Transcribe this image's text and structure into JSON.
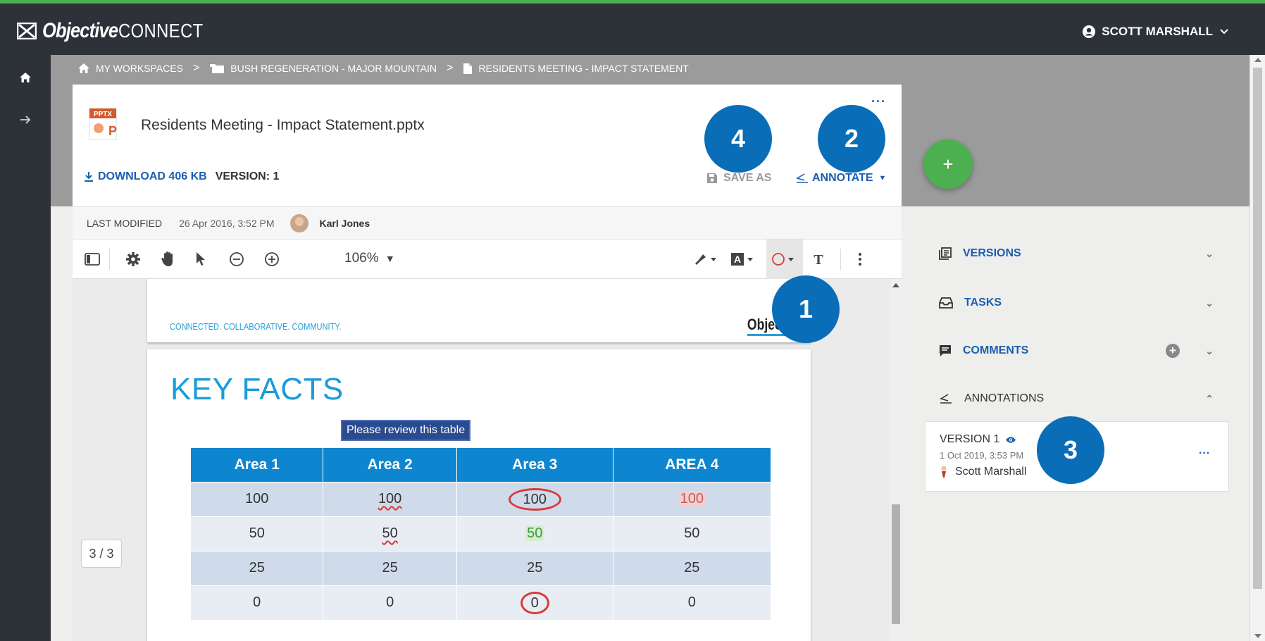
{
  "app": {
    "brand": "Objective",
    "product": "CONNECT",
    "accent_color": "#4caf50",
    "link_color": "#1a5fae",
    "callout_color": "#0a6db8"
  },
  "user": {
    "name": "SCOTT MARSHALL"
  },
  "breadcrumb": {
    "items": [
      {
        "label": "MY WORKSPACES",
        "icon": "home-icon"
      },
      {
        "label": "BUSH REGENERATION - MAJOR MOUNTAIN",
        "icon": "folder-icon"
      },
      {
        "label": "RESIDENTS MEETING - IMPACT STATEMENT",
        "icon": "document-icon"
      }
    ],
    "separator": ">"
  },
  "document": {
    "file_type": "PPTX",
    "title": "Residents Meeting - Impact Statement.pptx",
    "more": "···",
    "download_label": "DOWNLOAD 406 KB",
    "version_label": "VERSION: 1",
    "save_as_label": "SAVE AS",
    "annotate_label": "ANNOTATE"
  },
  "meta": {
    "last_modified_label": "LAST MODIFIED",
    "last_modified_date": "26 Apr 2016, 3:52 PM",
    "modified_by": "Karl Jones"
  },
  "toolbar": {
    "zoom": "106%",
    "zoom_caret": "▼"
  },
  "slide": {
    "tagline": "CONNECTED. COLLABORATIVE. COMMUNITY.",
    "brand_fragment": "Objecti",
    "heading": "KEY FACTS",
    "note": "Please review this table",
    "table": {
      "headers": [
        "Area 1",
        "Area 2",
        "Area 3",
        "AREA 4"
      ],
      "rows": [
        [
          "100",
          "100",
          "100",
          "100"
        ],
        [
          "50",
          "50",
          "50",
          "50"
        ],
        [
          "25",
          "25",
          "25",
          "25"
        ],
        [
          "0",
          "0",
          "0",
          "0"
        ]
      ]
    }
  },
  "pager": {
    "label": "3 / 3"
  },
  "fab": {
    "label": "+"
  },
  "panel": {
    "versions": "VERSIONS",
    "tasks": "TASKS",
    "comments": "COMMENTS",
    "annotations": "ANNOTATIONS",
    "annotation_card": {
      "version": "VERSION 1",
      "date": "1 Oct 2019, 3:53 PM",
      "user": "Scott Marshall",
      "more": "···"
    }
  },
  "callouts": [
    "1",
    "2",
    "3",
    "4"
  ]
}
